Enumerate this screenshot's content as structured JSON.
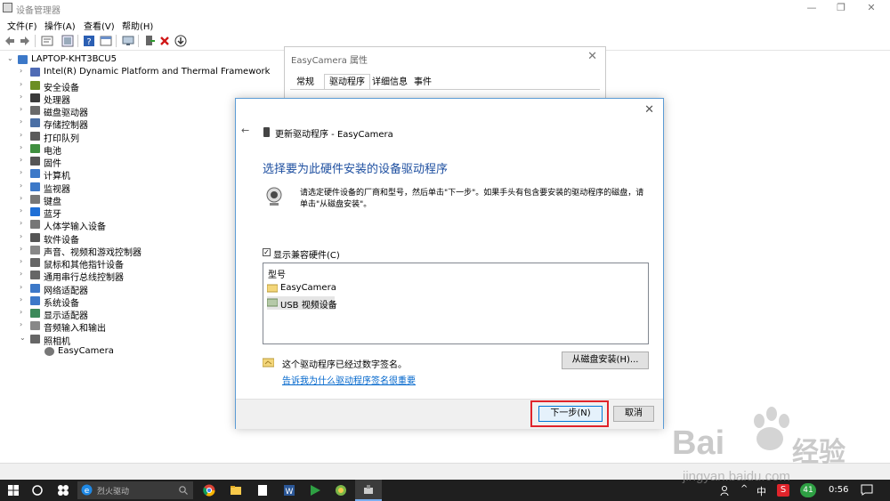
{
  "window": {
    "title": "设备管理器",
    "minimize": "—",
    "restore": "❐",
    "close": "✕"
  },
  "menu": [
    "文件(F)",
    "操作(A)",
    "查看(V)",
    "帮助(H)"
  ],
  "tree": {
    "root": "LAPTOP-KHT3BCU5",
    "items": [
      {
        "label": "Intel(R) Dynamic Platform and Thermal Framework",
        "icon": "chip-icon",
        "color": "#4f6bb5"
      },
      {
        "label": "安全设备",
        "icon": "security-device-icon",
        "color": "#6b8e23"
      },
      {
        "label": "处理器",
        "icon": "processor-icon",
        "color": "#3a3a3a"
      },
      {
        "label": "磁盘驱动器",
        "icon": "disk-drive-icon",
        "color": "#6a6a6a"
      },
      {
        "label": "存储控制器",
        "icon": "storage-controller-icon",
        "color": "#4a6fa5"
      },
      {
        "label": "打印队列",
        "icon": "printer-icon",
        "color": "#5a5a5a"
      },
      {
        "label": "电池",
        "icon": "battery-icon",
        "color": "#3f8f3f"
      },
      {
        "label": "固件",
        "icon": "firmware-icon",
        "color": "#555555"
      },
      {
        "label": "计算机",
        "icon": "computer-icon",
        "color": "#3c78c8"
      },
      {
        "label": "监视器",
        "icon": "monitor-icon",
        "color": "#3c78c8"
      },
      {
        "label": "键盘",
        "icon": "keyboard-icon",
        "color": "#777777"
      },
      {
        "label": "蓝牙",
        "icon": "bluetooth-icon",
        "color": "#1f6fd6"
      },
      {
        "label": "人体学输入设备",
        "icon": "hid-icon",
        "color": "#777777"
      },
      {
        "label": "软件设备",
        "icon": "software-device-icon",
        "color": "#555555"
      },
      {
        "label": "声音、视频和游戏控制器",
        "icon": "sound-icon",
        "color": "#888888"
      },
      {
        "label": "鼠标和其他指针设备",
        "icon": "mouse-icon",
        "color": "#666666"
      },
      {
        "label": "通用串行总线控制器",
        "icon": "usb-icon",
        "color": "#666666"
      },
      {
        "label": "网络适配器",
        "icon": "network-adapter-icon",
        "color": "#3c78c8"
      },
      {
        "label": "系统设备",
        "icon": "system-device-icon",
        "color": "#3c78c8"
      },
      {
        "label": "显示适配器",
        "icon": "display-adapter-icon",
        "color": "#3c8a5a"
      },
      {
        "label": "音频输入和输出",
        "icon": "audio-io-icon",
        "color": "#888888"
      },
      {
        "label": "照相机",
        "icon": "camera-icon",
        "color": "#666666"
      }
    ],
    "child": "EasyCamera"
  },
  "props": {
    "title": "EasyCamera 属性",
    "close": "✕",
    "tabs": [
      "常规",
      "驱动程序",
      "详细信息",
      "事件"
    ],
    "active_tab": 1
  },
  "dialog": {
    "close": "✕",
    "back": "←",
    "header": "更新驱动程序 - EasyCamera",
    "heading": "选择要为此硬件安装的设备驱动程序",
    "instruction": "请选定硬件设备的厂商和型号，然后单击\"下一步\"。如果手头有包含要安装的驱动程序的磁盘，请单击\"从磁盘安装\"。",
    "show_compatible": "显示兼容硬件(C)",
    "show_compatible_checked": true,
    "list_header": "型号",
    "models": [
      "EasyCamera",
      "USB 视频设备"
    ],
    "selected_model": 1,
    "signed_text": "这个驱动程序已经过数字签名。",
    "signing_link": "告诉我为什么驱动程序签名很重要",
    "have_disk": "从磁盘安装(H)...",
    "next": "下一步(N)",
    "cancel": "取消",
    "heading_color": "#1e4fa0",
    "link_color": "#0066cc",
    "highlight_color": "#e0242b"
  },
  "taskbar": {
    "search_placeholder": "烈火驱动",
    "badge": "41",
    "ime": "中",
    "clock": "0:56"
  },
  "watermark": {
    "text": "Bai",
    "cn": "经验",
    "url": "jingyan.baidu.com"
  }
}
